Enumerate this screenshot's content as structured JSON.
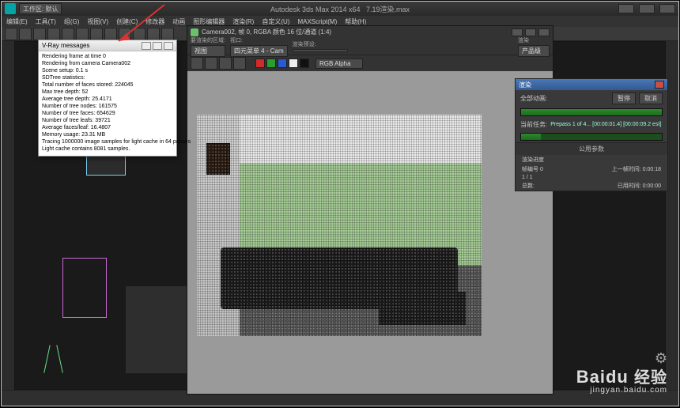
{
  "app": {
    "title_center": "Autodesk 3ds Max  2014 x64",
    "filename": "7.19渲染.max",
    "workspace_label": "工作区: 默认"
  },
  "menu": [
    "编辑(E)",
    "工具(T)",
    "组(G)",
    "视图(V)",
    "创建(C)",
    "修改器",
    "动画",
    "图形编辑器",
    "渲染(R)",
    "自定义(U)",
    "MAXScript(M)",
    "帮助(H)"
  ],
  "vray": {
    "title": "V-Ray messages",
    "lines": [
      "Rendering frame at time 0",
      "Rendering from camera Camera002",
      "Scene setup: 0.1 s",
      "SDTree statistics:",
      "Total number of faces stored: 224045",
      "Max tree depth: 52",
      "Average tree depth: 25.4171",
      "Number of tree nodes: 161575",
      "Number of tree faces: 654629",
      "Number of tree leafs: 39721",
      "Average faces/leaf: 16.4807",
      "Memory usage: 23.31 MB",
      "Tracing 1000000 image samples for light cache in 64 passes",
      "Light cache contains 8081 samples."
    ]
  },
  "render_window": {
    "title": "Camera002, 帧 0, RGBA 颜色 16 位/通道 (1:4)",
    "area_label": "要渲染的区域:",
    "area_value": "视图",
    "viewport_label": "视口:",
    "viewport_value": "四元菜单 4 - Cam",
    "preset_label": "渲染预设:",
    "output_label": "渲染",
    "output_value": "产品级",
    "alpha": "RGB Alpha"
  },
  "progress": {
    "title": "渲染",
    "total_label": "全部动画:",
    "pause": "暂停",
    "cancel": "取消",
    "task_label": "当前任务:",
    "task_text": "Prepass 1 of 4... [00:00:01.4] [00:00:09.2 est]",
    "section": "公用参数",
    "stats": [
      {
        "l": "渲染进度",
        "v": ""
      },
      {
        "l": "帧编号  0",
        "v": "上一帧时间: 0:00:18"
      },
      {
        "l": "1 / 1",
        "v": ""
      },
      {
        "l": "总数:",
        "v": "已用时间: 0:00:00"
      }
    ]
  },
  "colors": {
    "red": "#d02a2a",
    "green": "#2aa02a",
    "blue": "#2a5ad0",
    "white": "#eee",
    "black": "#111"
  },
  "watermark": {
    "brand": "Baidu",
    "cn": "经验",
    "url": "jingyan.baidu.com"
  }
}
